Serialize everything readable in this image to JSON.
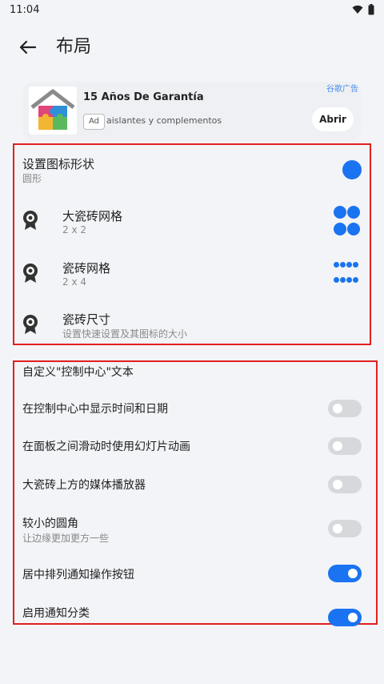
{
  "status_bar": {
    "time": "11:04"
  },
  "header": {
    "title": "布局"
  },
  "ad": {
    "title": "15 Años De Garantía",
    "badge": "Ad",
    "description": "aislantes y complementos",
    "label": "谷歌广告",
    "cta": "Abrir"
  },
  "layout_section": {
    "icon_shape": {
      "title": "设置图标形状",
      "value": "圆形"
    },
    "big_tile_grid": {
      "title": "大瓷砖网格",
      "value": "2 x 2"
    },
    "tile_grid": {
      "title": "瓷砖网格",
      "value": "2 x 4"
    },
    "tile_size": {
      "title": "瓷砖尺寸",
      "subtitle": "设置快速设置及其图标的大小"
    }
  },
  "control_center": {
    "header": "自定义\"控制中心\"文本",
    "items": [
      {
        "title": "在控制中心中显示时间和日期",
        "subtitle": "",
        "enabled": false
      },
      {
        "title": "在面板之间滑动时使用幻灯片动画",
        "subtitle": "",
        "enabled": false
      },
      {
        "title": "大瓷砖上方的媒体播放器",
        "subtitle": "",
        "enabled": false
      },
      {
        "title": "较小的圆角",
        "subtitle": "让边缘更加更方一些",
        "enabled": false
      },
      {
        "title": "居中排列通知操作按钮",
        "subtitle": "",
        "enabled": true
      },
      {
        "title": "启用通知分类",
        "subtitle": "",
        "enabled": true
      }
    ]
  },
  "colors": {
    "accent": "#1a73f0",
    "highlight_border": "#e02020",
    "toggle_off": "#d6d8db"
  }
}
